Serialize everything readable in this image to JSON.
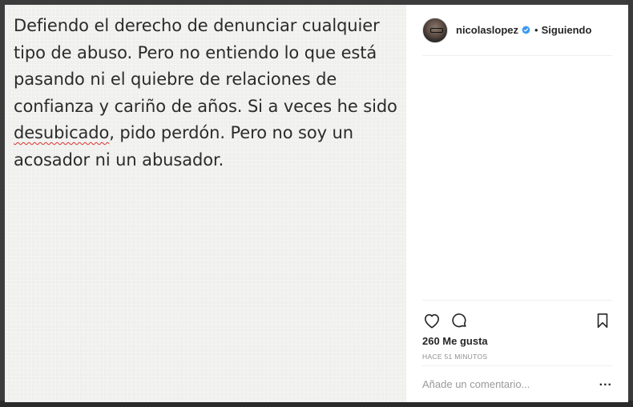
{
  "post": {
    "text_line_1": "Defiendo el derecho de denunciar cualquier",
    "text_line_2": "tipo de abuso. Pero no entiendo lo que está",
    "text_line_3": "pasando ni el quiebre de relaciones de",
    "text_line_4": "confianza y cariño de años. Si a veces he sido",
    "text_line_5_misspelled": "desubicado",
    "text_line_5_rest": ", pido perdón. Pero no soy un",
    "text_line_6": "acosador ni un abusador."
  },
  "header": {
    "username": "nicolaslopez",
    "separator": "•",
    "follow_status": "Siguiendo"
  },
  "engagement": {
    "likes": "260 Me gusta",
    "timestamp": "HACE 51 MINUTOS"
  },
  "comment": {
    "placeholder": "Añade un comentario...",
    "more_label": "..."
  },
  "icons": {
    "like": "heart-icon",
    "comment": "comment-icon",
    "save": "bookmark-icon",
    "verified": "verified-badge-icon"
  },
  "colors": {
    "verified": "#3897f0",
    "spellcheck": "#d9342b",
    "text": "#262626",
    "muted": "#8e8e8e"
  }
}
